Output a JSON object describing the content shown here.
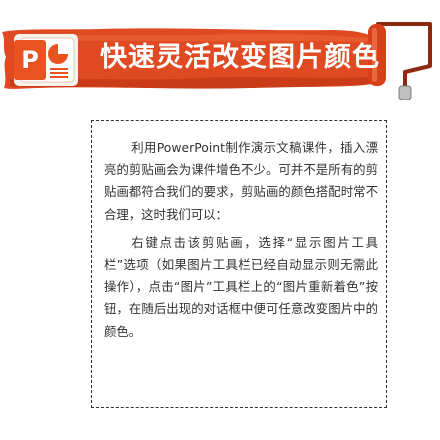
{
  "banner": {
    "title": "快速灵活改变图片颜色",
    "logo_letter": "P",
    "colors": {
      "banner_red": "#e04a22",
      "banner_dark": "#b8320f",
      "logo_orange": "#e8531f",
      "text": "#333333"
    }
  },
  "content": {
    "paragraphs": [
      "利用PowerPoint制作演示文稿课件，插入漂亮的剪贴画会为课件增色不少。可并不是所有的剪贴画都符合我们的要求，剪贴画的颜色搭配时常不合理，这时我们可以：",
      "右键点击该剪贴画，选择“显示图片工具栏”选项（如果图片工具栏已经自动显示则无需此操作），点击“图片”工具栏上的“图片重新着色”按钮，在随后出现的对话框中便可任意改变图片中的颜色。"
    ]
  }
}
